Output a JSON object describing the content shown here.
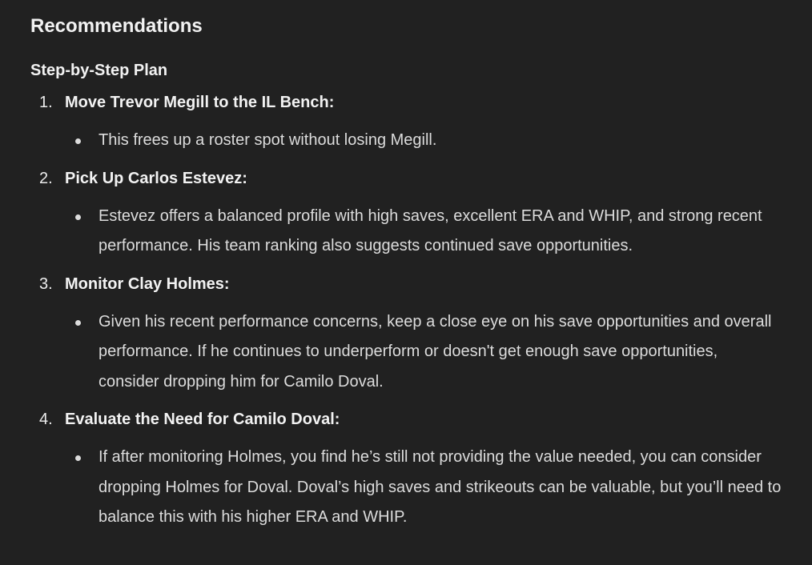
{
  "heading": "Recommendations",
  "subheading": "Step-by-Step Plan",
  "steps": [
    {
      "number": "1.",
      "title": "Move Trevor Megill to the IL Bench:",
      "bullet": "This frees up a roster spot without losing Megill."
    },
    {
      "number": "2.",
      "title": "Pick Up Carlos Estevez:",
      "bullet": "Estevez offers a balanced profile with high saves, excellent ERA and WHIP, and strong recent performance. His team ranking also suggests continued save opportunities."
    },
    {
      "number": "3.",
      "title": "Monitor Clay Holmes:",
      "bullet": "Given his recent performance concerns, keep a close eye on his save opportunities and overall performance. If he continues to underperform or doesn't get enough save opportunities, consider dropping him for Camilo Doval."
    },
    {
      "number": "4.",
      "title": "Evaluate the Need for Camilo Doval:",
      "bullet": "If after monitoring Holmes, you find he’s still not providing the value needed, you can consider dropping Holmes for Doval. Doval’s high saves and strikeouts can be valuable, but you’ll need to balance this with his higher ERA and WHIP."
    }
  ]
}
